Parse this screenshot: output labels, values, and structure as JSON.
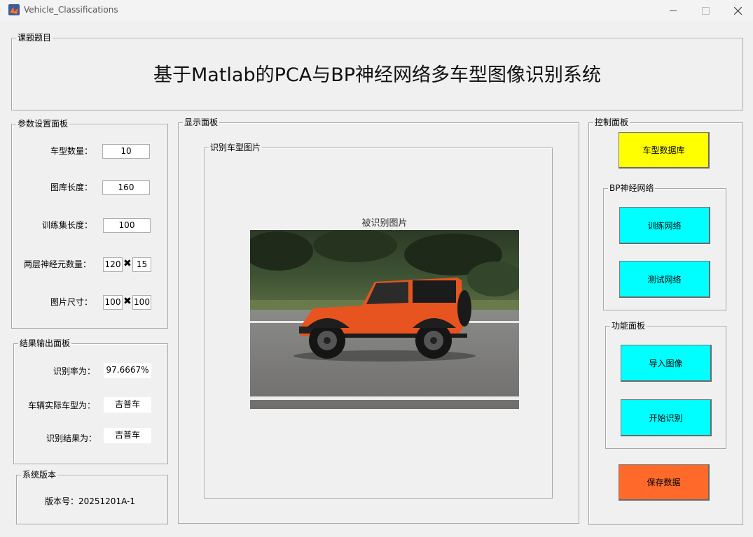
{
  "window": {
    "title": "Vehicle_Classifications"
  },
  "title_panel": {
    "legend": "课题题目",
    "title": "基于Matlab的PCA与BP神经网络多车型图像识别系统"
  },
  "params": {
    "legend": "参数设置面板",
    "vehicle_types_label": "车型数量：",
    "vehicle_types_value": "10",
    "library_length_label": "图库长度：",
    "library_length_value": "160",
    "train_length_label": "训练集长度：",
    "train_length_value": "100",
    "neurons_label": "两层神经元数量：",
    "neurons_1": "120",
    "neurons_2": "15",
    "size_label": "图片尺寸：",
    "size_w": "100",
    "size_h": "100",
    "times_symbol": "✖"
  },
  "results": {
    "legend": "结果输出面板",
    "accuracy_label": "识别率为：",
    "accuracy_value": "97.6667%",
    "actual_label": "车辆实际车型为：",
    "actual_value": "吉普车",
    "result_label": "识别结果为：",
    "result_value": "吉普车"
  },
  "version": {
    "legend": "系统版本",
    "text": "版本号：20251201A-1"
  },
  "display": {
    "legend": "显示面板",
    "sub_legend": "识别车型图片",
    "image_caption": "被识别图片"
  },
  "control": {
    "legend": "控制面板",
    "db_button": "车型数据库",
    "bp_legend": "BP神经网络",
    "train_button": "训练网络",
    "test_button": "测试网络",
    "func_legend": "功能面板",
    "import_button": "导入图像",
    "recognize_button": "开始识别",
    "save_button": "保存数据"
  },
  "colors": {
    "yellow": "#ffff00",
    "cyan": "#00ffff",
    "orange": "#ff6a2a"
  }
}
